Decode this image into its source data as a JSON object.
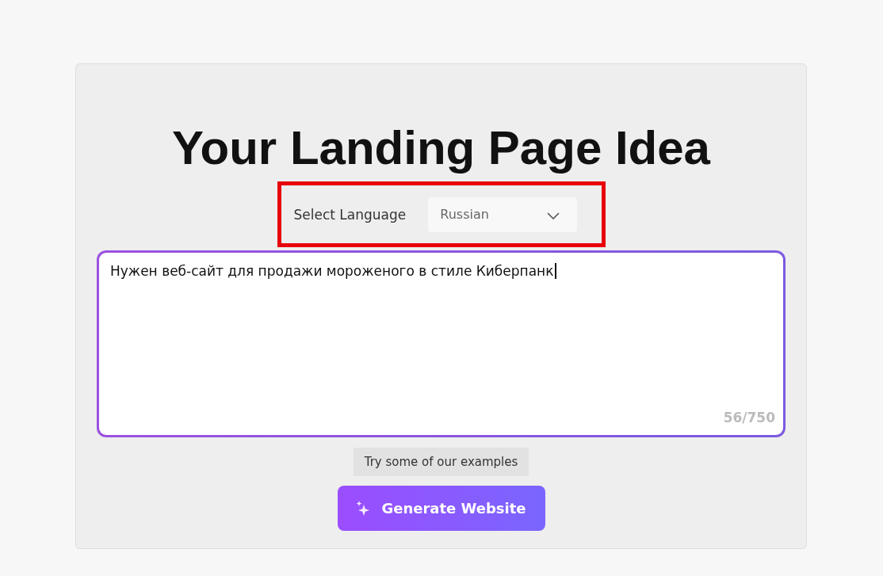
{
  "title": "Your Landing Page Idea",
  "language": {
    "label": "Select Language",
    "value": "Russian",
    "highlighted": true
  },
  "idea": {
    "value": "Нужен веб-сайт для продажи мороженого в стиле Киберпанк",
    "counter": "56/750"
  },
  "examples_button": "Try some of our examples",
  "generate_button": "Generate Website"
}
